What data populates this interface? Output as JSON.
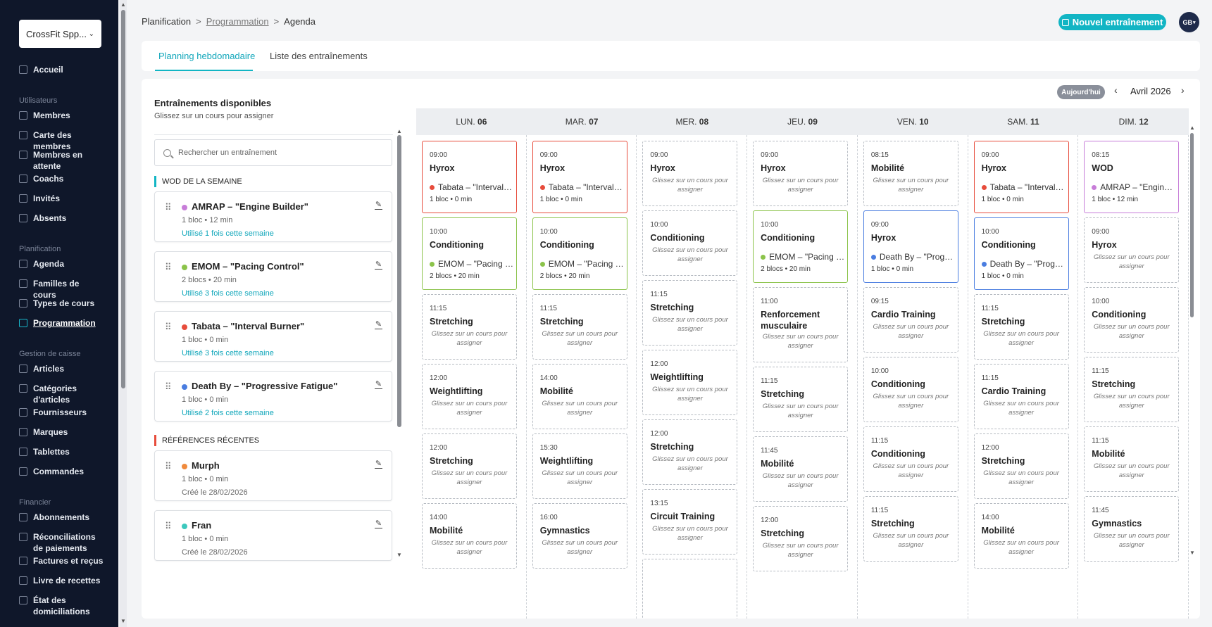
{
  "sidebar": {
    "gym": "CrossFit Spp...",
    "sections": [
      {
        "label": "",
        "items": [
          "Accueil"
        ]
      },
      {
        "label": "Utilisateurs",
        "items": [
          "Membres",
          "Carte des membres",
          "Membres en attente",
          "Coachs",
          "Invités",
          "Absents"
        ]
      },
      {
        "label": "Planification",
        "items": [
          "Agenda",
          "Familles de cours",
          "Types de cours",
          "Programmation"
        ]
      },
      {
        "label": "Gestion de caisse",
        "items": [
          "Articles",
          "Catégories d'articles",
          "Fournisseurs",
          "Marques",
          "Tablettes",
          "Commandes"
        ]
      },
      {
        "label": "Financier",
        "items": [
          "Abonnements",
          "Réconciliations de paiements",
          "Factures et reçus",
          "Livre de recettes",
          "État des domiciliations"
        ]
      }
    ],
    "active_item": "Programmation"
  },
  "header": {
    "breadcrumb": [
      "Planification",
      "Programmation",
      "Agenda"
    ],
    "new_button": "Nouvel entraînement",
    "avatar": "GB",
    "avatar_caret": "▾"
  },
  "tabs": [
    "Planning hebdomadaire",
    "Liste des entraînements"
  ],
  "available": {
    "title": "Entraînements disponibles",
    "subtitle": "Glissez sur un cours pour assigner",
    "search_placeholder": "Rechercher un entraînement",
    "sections": [
      {
        "label": "WOD DE LA SEMAINE",
        "cards": [
          {
            "name": "AMRAP – \"Engine Builder\"",
            "color": "#c77dd8",
            "meta": "1 bloc  •  12 min",
            "usage": "Utilisé 1 fois cette semaine"
          },
          {
            "name": "EMOM – \"Pacing Control\"",
            "color": "#8bc34a",
            "meta": "2 blocs  •  20 min",
            "usage": "Utilisé 3 fois cette semaine"
          },
          {
            "name": "Tabata – \"Interval Burner\"",
            "color": "#e74c3c",
            "meta": "1 bloc  •  0 min",
            "usage": "Utilisé 3 fois cette semaine"
          },
          {
            "name": "Death By – \"Progressive Fatigue\"",
            "color": "#4a7de0",
            "meta": "1 bloc  •  0 min",
            "usage": "Utilisé 2 fois cette semaine"
          }
        ]
      },
      {
        "label": "RÉFÉRENCES RÉCENTES",
        "cards": [
          {
            "name": "Murph",
            "color": "#f08a3c",
            "meta": "1 bloc  •  0 min",
            "usage": "Créé le 28/02/2026"
          },
          {
            "name": "Fran",
            "color": "#3cc8bd",
            "meta": "1 bloc  •  0 min",
            "usage": "Créé le 28/02/2026"
          }
        ]
      }
    ]
  },
  "calendar": {
    "today_button": "Aujourd'hui",
    "month": "Avril 2026",
    "prev_icon": "‹",
    "next_icon": "›",
    "hint": "Glissez sur un cours pour assigner",
    "days": [
      {
        "prefix": "LUN.",
        "num": "06",
        "slots": [
          {
            "time": "09:00",
            "title": "Hyrox",
            "border": "#e74c3c",
            "workout": "Tabata – \"Interval Burner\"",
            "dot": "#e74c3c",
            "meta": "1 bloc • 0 min"
          },
          {
            "time": "10:00",
            "title": "Conditioning",
            "border": "#8bc34a",
            "workout": "EMOM – \"Pacing Control\"",
            "dot": "#8bc34a",
            "meta": "2 blocs • 20 min"
          },
          {
            "time": "11:15",
            "title": "Stretching"
          },
          {
            "time": "12:00",
            "title": "Weightlifting"
          },
          {
            "time": "12:00",
            "title": "Stretching"
          },
          {
            "time": "14:00",
            "title": "Mobilité"
          }
        ]
      },
      {
        "prefix": "MAR.",
        "num": "07",
        "slots": [
          {
            "time": "09:00",
            "title": "Hyrox",
            "border": "#e74c3c",
            "workout": "Tabata – \"Interval Burner\"",
            "dot": "#e74c3c",
            "meta": "1 bloc • 0 min"
          },
          {
            "time": "10:00",
            "title": "Conditioning",
            "border": "#8bc34a",
            "workout": "EMOM – \"Pacing Control\"",
            "dot": "#8bc34a",
            "meta": "2 blocs • 20 min"
          },
          {
            "time": "11:15",
            "title": "Stretching"
          },
          {
            "time": "14:00",
            "title": "Mobilité"
          },
          {
            "time": "15:30",
            "title": "Weightlifting"
          },
          {
            "time": "16:00",
            "title": "Gymnastics"
          }
        ]
      },
      {
        "prefix": "MER.",
        "num": "08",
        "slots": [
          {
            "time": "09:00",
            "title": "Hyrox"
          },
          {
            "time": "10:00",
            "title": "Conditioning"
          },
          {
            "time": "11:15",
            "title": "Stretching"
          },
          {
            "time": "12:00",
            "title": "Weightlifting"
          },
          {
            "time": "12:00",
            "title": "Stretching"
          },
          {
            "time": "13:15",
            "title": "Circuit Training"
          },
          {
            "time": "",
            "title": ""
          }
        ]
      },
      {
        "prefix": "JEU.",
        "num": "09",
        "slots": [
          {
            "time": "09:00",
            "title": "Hyrox"
          },
          {
            "time": "10:00",
            "title": "Conditioning",
            "border": "#8bc34a",
            "workout": "EMOM – \"Pacing Control\"",
            "dot": "#8bc34a",
            "meta": "2 blocs • 20 min"
          },
          {
            "time": "11:00",
            "title": "Renforcement musculaire",
            "tall": true
          },
          {
            "time": "11:15",
            "title": "Stretching"
          },
          {
            "time": "11:45",
            "title": "Mobilité"
          },
          {
            "time": "12:00",
            "title": "Stretching"
          }
        ]
      },
      {
        "prefix": "VEN.",
        "num": "10",
        "slots": [
          {
            "time": "08:15",
            "title": "Mobilité"
          },
          {
            "time": "09:00",
            "title": "Hyrox",
            "border": "#4a7de0",
            "workout": "Death By – \"Progressive Fatigue\"",
            "dot": "#4a7de0",
            "meta": "1 bloc • 0 min"
          },
          {
            "time": "09:15",
            "title": "Cardio Training"
          },
          {
            "time": "10:00",
            "title": "Conditioning"
          },
          {
            "time": "11:15",
            "title": "Conditioning"
          },
          {
            "time": "11:15",
            "title": "Stretching"
          }
        ]
      },
      {
        "prefix": "SAM.",
        "num": "11",
        "slots": [
          {
            "time": "09:00",
            "title": "Hyrox",
            "border": "#e74c3c",
            "workout": "Tabata – \"Interval Burner\"",
            "dot": "#e74c3c",
            "meta": "1 bloc • 0 min"
          },
          {
            "time": "10:00",
            "title": "Conditioning",
            "border": "#4a7de0",
            "workout": "Death By – \"Progressive Fatigue\"",
            "dot": "#4a7de0",
            "meta": "1 bloc • 0 min"
          },
          {
            "time": "11:15",
            "title": "Stretching"
          },
          {
            "time": "11:15",
            "title": "Cardio Training"
          },
          {
            "time": "12:00",
            "title": "Stretching"
          },
          {
            "time": "14:00",
            "title": "Mobilité"
          }
        ]
      },
      {
        "prefix": "DIM.",
        "num": "12",
        "slots": [
          {
            "time": "08:15",
            "title": "WOD",
            "border": "#c77dd8",
            "workout": "AMRAP – \"Engine Builder\"",
            "dot": "#c77dd8",
            "meta": "1 bloc • 12 min"
          },
          {
            "time": "09:00",
            "title": "Hyrox"
          },
          {
            "time": "10:00",
            "title": "Conditioning"
          },
          {
            "time": "11:15",
            "title": "Stretching"
          },
          {
            "time": "11:15",
            "title": "Mobilité"
          },
          {
            "time": "11:45",
            "title": "Gymnastics"
          }
        ]
      }
    ]
  }
}
